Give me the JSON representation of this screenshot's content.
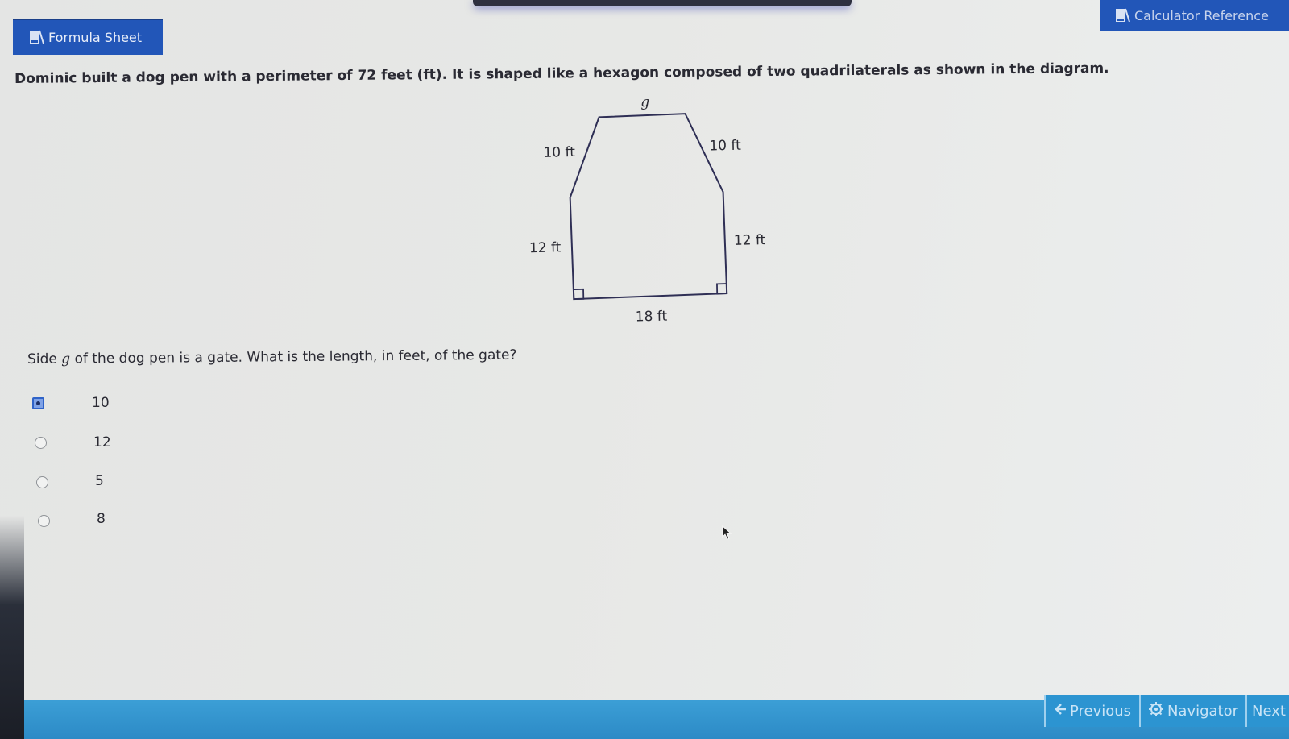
{
  "toolbar": {
    "formula_sheet_label": "Formula Sheet",
    "calculator_reference_label": "Calculator Reference"
  },
  "question": {
    "prompt": "Dominic built a dog pen with a perimeter of 72 feet (ft). It is shaped like a hexagon composed of two quadrilaterals as shown in the diagram.",
    "stem_before": "Side ",
    "stem_variable": "g",
    "stem_after": " of the dog pen is a gate. What is the length, in feet, of the gate?"
  },
  "diagram": {
    "top_label": "g",
    "upper_left_label": "10 ft",
    "upper_right_label": "10 ft",
    "left_label": "12 ft",
    "right_label": "12 ft",
    "bottom_label": "18 ft"
  },
  "choices": [
    {
      "label": "10",
      "selected": true
    },
    {
      "label": "12",
      "selected": false
    },
    {
      "label": "5",
      "selected": false
    },
    {
      "label": "8",
      "selected": false
    }
  ],
  "navigation": {
    "previous_label": "Previous",
    "navigator_label": "Navigator",
    "next_label": "Next"
  },
  "colors": {
    "button_blue": "#2256b8",
    "bottom_bar": "#2c8ac6",
    "selected_radio": "#2f63c8"
  }
}
